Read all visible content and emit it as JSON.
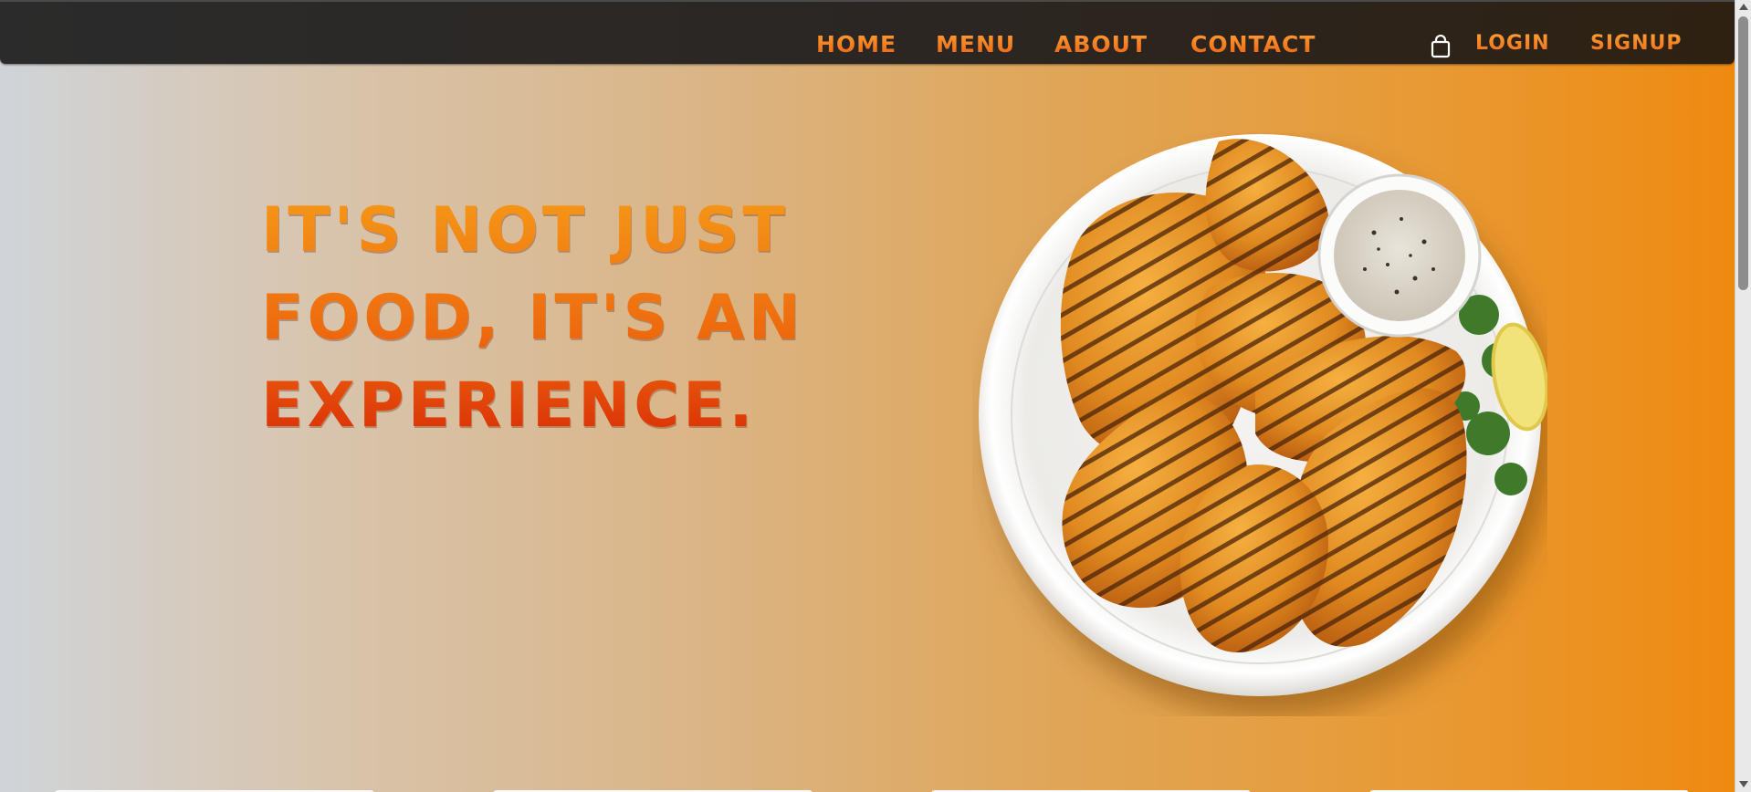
{
  "nav": {
    "home": "HOME",
    "menu": "MENU",
    "about": "ABOUT",
    "contact": "CONTACT",
    "cart_icon": "shopping-bag-icon",
    "login": "LOGIN",
    "signup": "SIGNUP"
  },
  "hero": {
    "line1": "IT'S NOT JUST",
    "line2": "FOOD, IT'S AN",
    "line3": "EXPERIENCE.",
    "image_subject": "plate-of-grilled-chicken-icon"
  },
  "colors": {
    "accent": "#ee8a10",
    "nav_bg": "#2b2622",
    "title_top": "#f59a18",
    "title_bottom": "#d92a06"
  }
}
